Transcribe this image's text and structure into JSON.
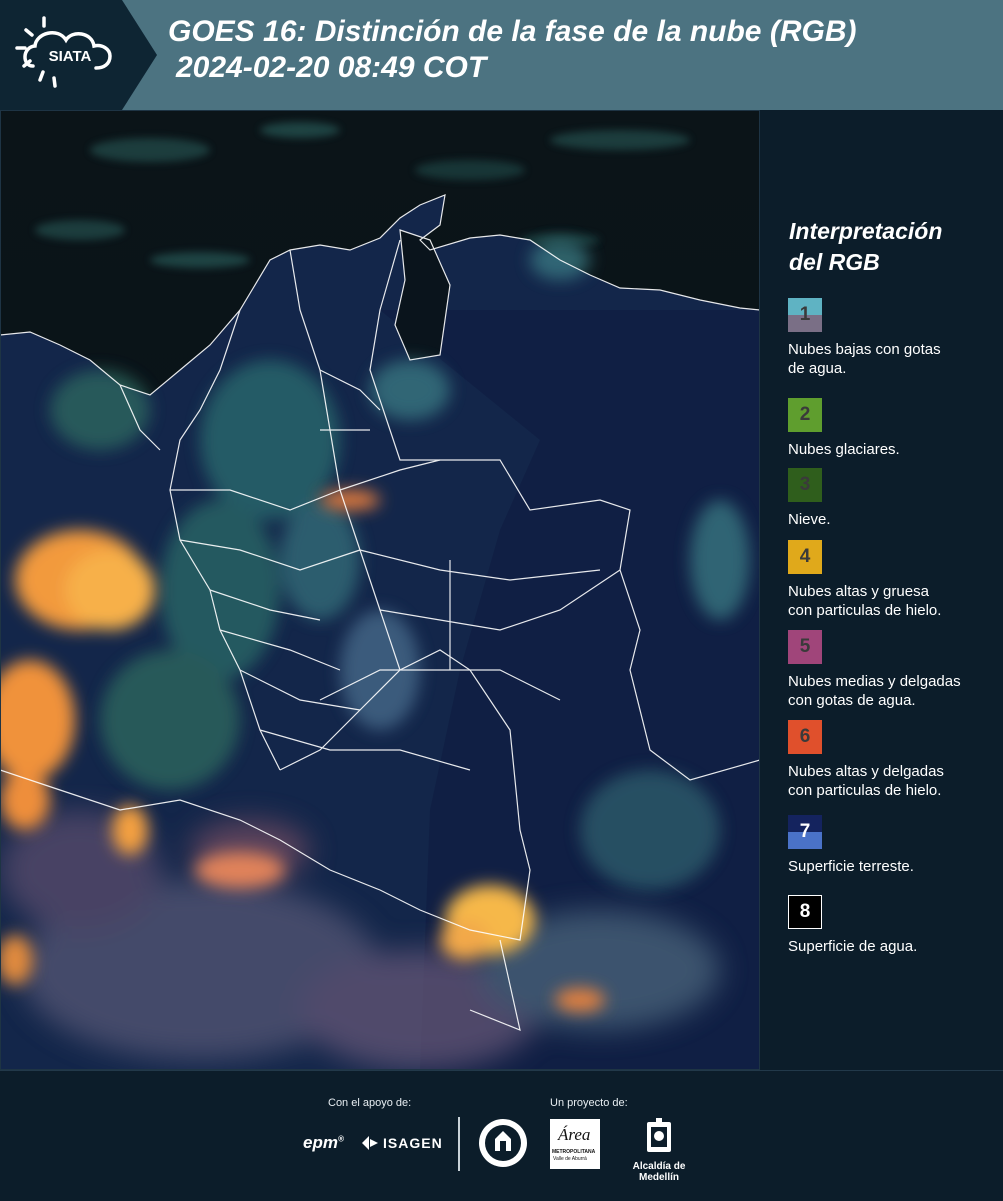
{
  "header": {
    "logo_text": "SIATA",
    "title_line1": "GOES 16: Distinción de la fase de la nube (RGB)",
    "title_line2": "2024-02-20 08:49 COT"
  },
  "legend": {
    "title_line1": "Interpretación",
    "title_line2": "del RGB",
    "items": [
      {
        "num": "1",
        "label_line1": "Nubes bajas con gotas",
        "label_line2": "de agua.",
        "color_top": "#5fb3c3",
        "color_bottom": "#7a6f86"
      },
      {
        "num": "2",
        "label_line1": "Nubes glaciares.",
        "label_line2": "",
        "color_top": "#5f9e2e",
        "color_bottom": "#5f9e2e"
      },
      {
        "num": "3",
        "label_line1": "Nieve.",
        "label_line2": "",
        "color_top": "#2f5e1c",
        "color_bottom": "#2f5e1c"
      },
      {
        "num": "4",
        "label_line1": "Nubes altas y gruesa",
        "label_line2": "con particulas de hielo.",
        "color_top": "#e0a91b",
        "color_bottom": "#e0a91b"
      },
      {
        "num": "5",
        "label_line1": "Nubes medias y delgadas",
        "label_line2": "con gotas de agua.",
        "color_top": "#a0457a",
        "color_bottom": "#a0457a"
      },
      {
        "num": "6",
        "label_line1": "Nubes altas y delgadas",
        "label_line2": "con particulas de hielo.",
        "color_top": "#e0502c",
        "color_bottom": "#e0502c"
      },
      {
        "num": "7",
        "label_line1": "Superficie terreste.",
        "label_line2": "",
        "color_top": "#14235e",
        "color_bottom": "#4a72c8"
      },
      {
        "num": "8",
        "label_line1": "Superficie de agua.",
        "label_line2": "",
        "color_top": "#000000",
        "color_bottom": "#000000"
      }
    ]
  },
  "footer": {
    "support_label": "Con el apoyo de:",
    "project_label": "Un proyecto de:",
    "epm_text": "epm",
    "isagen_text": "ISAGEN",
    "area_text_1": "METROPOLITANA",
    "area_text_2": "Valle de Aburrá",
    "area_script": "Área",
    "alcaldia_text": "Alcaldía de Medellín"
  }
}
